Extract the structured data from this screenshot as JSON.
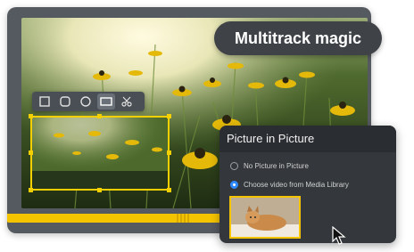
{
  "badge": {
    "title": "Multitrack magic"
  },
  "toolbar": {
    "tools": [
      {
        "icon": "square-icon"
      },
      {
        "icon": "rounded-square-icon"
      },
      {
        "icon": "circle-icon"
      },
      {
        "icon": "rectangle-icon",
        "active": true
      },
      {
        "icon": "scissors-icon"
      }
    ]
  },
  "panel": {
    "title": "Picture in Picture",
    "options": [
      {
        "label": "No Picture in Picture",
        "selected": false
      },
      {
        "label": "Choose video from Media Library",
        "selected": true
      }
    ]
  },
  "colors": {
    "accent": "#f5c400",
    "frame": "#555a60",
    "panel": "#34383c",
    "radio_on": "#2f88ff"
  }
}
